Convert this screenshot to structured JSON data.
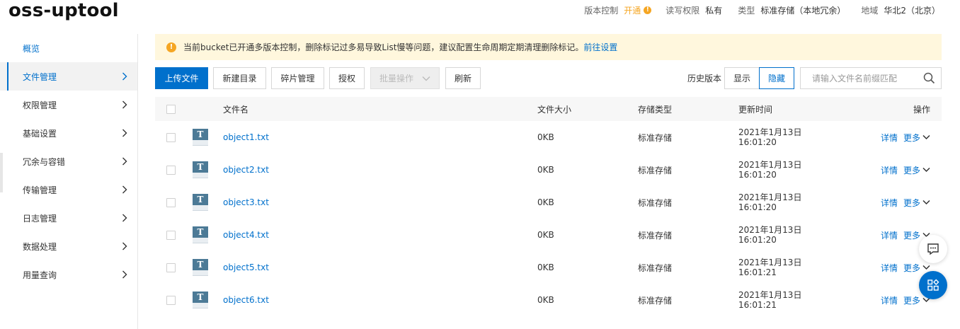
{
  "bucket": {
    "name": "oss-uptool"
  },
  "meta": {
    "version_label": "版本控制",
    "version_value": "开通",
    "acl_label": "读写权限",
    "acl_value": "私有",
    "type_label": "类型",
    "type_value": "标准存储（本地冗余）",
    "region_label": "地域",
    "region_value": "华北2（北京）"
  },
  "sidebar": {
    "items": [
      {
        "label": "概览"
      },
      {
        "label": "文件管理"
      },
      {
        "label": "权限管理"
      },
      {
        "label": "基础设置"
      },
      {
        "label": "冗余与容错"
      },
      {
        "label": "传输管理"
      },
      {
        "label": "日志管理"
      },
      {
        "label": "数据处理"
      },
      {
        "label": "用量查询"
      }
    ]
  },
  "notice": {
    "text": "当前bucket已开通多版本控制，删除标记过多易导致List慢等问题，建议配置生命周期定期清理删除标记。",
    "link": "前往设置"
  },
  "toolbar": {
    "upload": "上传文件",
    "new_dir": "新建目录",
    "fragments": "碎片管理",
    "authorize": "授权",
    "batch": "批量操作",
    "refresh": "刷新",
    "history_label": "历史版本",
    "show": "显示",
    "hide": "隐藏",
    "search_placeholder": "请输入文件名前缀匹配"
  },
  "table": {
    "headers": {
      "name": "文件名",
      "size": "文件大小",
      "storage": "存储类型",
      "updated": "更新时间",
      "ops": "操作"
    },
    "rows": [
      {
        "name": "object1.txt",
        "size": "0KB",
        "storage": "标准存储",
        "date": "2021年1月13日",
        "time": "16:01:20",
        "detail": "详情",
        "more": "更多"
      },
      {
        "name": "object2.txt",
        "size": "0KB",
        "storage": "标准存储",
        "date": "2021年1月13日",
        "time": "16:01:20",
        "detail": "详情",
        "more": "更多"
      },
      {
        "name": "object3.txt",
        "size": "0KB",
        "storage": "标准存储",
        "date": "2021年1月13日",
        "time": "16:01:20",
        "detail": "详情",
        "more": "更多"
      },
      {
        "name": "object4.txt",
        "size": "0KB",
        "storage": "标准存储",
        "date": "2021年1月13日",
        "time": "16:01:20",
        "detail": "详情",
        "more": "更多"
      },
      {
        "name": "object5.txt",
        "size": "0KB",
        "storage": "标准存储",
        "date": "2021年1月13日",
        "time": "16:01:21",
        "detail": "详情",
        "more": "更多"
      },
      {
        "name": "object6.txt",
        "size": "0KB",
        "storage": "标准存储",
        "date": "2021年1月13日",
        "time": "16:01:21",
        "detail": "详情",
        "more": "更多"
      }
    ]
  },
  "colors": {
    "accent": "#0070cc",
    "warning": "#f5a623",
    "notice_bg": "#fff7dd"
  }
}
